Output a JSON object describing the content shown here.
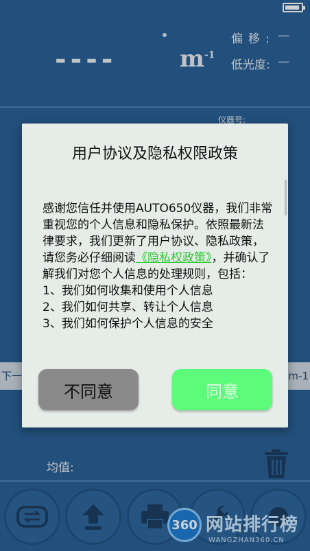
{
  "app": {
    "reading": "----",
    "unit_base": "m",
    "unit_exp": "-1",
    "offset_label": "偏移:",
    "offset_value": "—",
    "lowlight_label": "低光度:",
    "lowlight_value": "—",
    "device_label": "仪器号:",
    "next_label": "下一",
    "unit_button": "m-1",
    "average_label": "均值:"
  },
  "toolbar": {
    "icons": [
      "swap-icon",
      "upload-icon",
      "printer-icon",
      "wrench-icon",
      "settings-icon"
    ]
  },
  "dialog": {
    "title": "用户协议及隐私权限政策",
    "intro_before_link": "感谢您信任并使用AUTO650仪器，我们非常重视您的个人信息和隐私保护。依照最新法律要求，我们更新了用户协议、隐私政策，请您务必仔细阅读",
    "policy_link": "《隐私权政策》",
    "intro_after_link": "，并确认了解我们对您个人信息的处理规则，包括：",
    "items": [
      "1、我们如何收集和使用个人信息",
      "2、我们如何共享、转让个人信息",
      "3、我们如何保护个人信息的安全"
    ],
    "disagree_label": "不同意",
    "agree_label": "同意"
  },
  "watermark": {
    "badge": "360",
    "title": "网站排行榜",
    "domain": "WANGZHAN360.CN"
  },
  "colors": {
    "background": "#2a6196",
    "dialog": "#e6ece7",
    "link": "#2fc637",
    "agree": "#5dfb7a",
    "disagree": "#8a8a8a"
  }
}
